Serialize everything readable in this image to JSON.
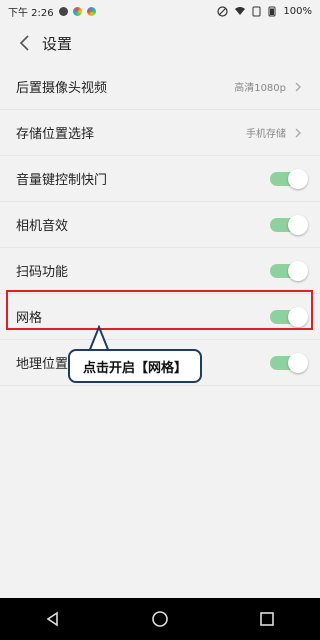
{
  "status_bar": {
    "time": "下午 2:26",
    "battery": "100%"
  },
  "header": {
    "title": "设置"
  },
  "settings": [
    {
      "label": "后置摄像头视频",
      "value": "高清1080p"
    },
    {
      "label": "存储位置选择",
      "value": "手机存储"
    },
    {
      "label": "音量键控制快门",
      "toggle": true
    },
    {
      "label": "相机音效",
      "toggle": true
    },
    {
      "label": "扫码功能",
      "toggle": true
    },
    {
      "label": "网格",
      "toggle": true
    },
    {
      "label": "地理位置",
      "toggle": true
    }
  ],
  "callout": {
    "text": "点击开启【网格】"
  },
  "colors": {
    "toggle_on": "#8fd19e",
    "highlight": "#e02020",
    "callout_border": "#1f3b63"
  }
}
